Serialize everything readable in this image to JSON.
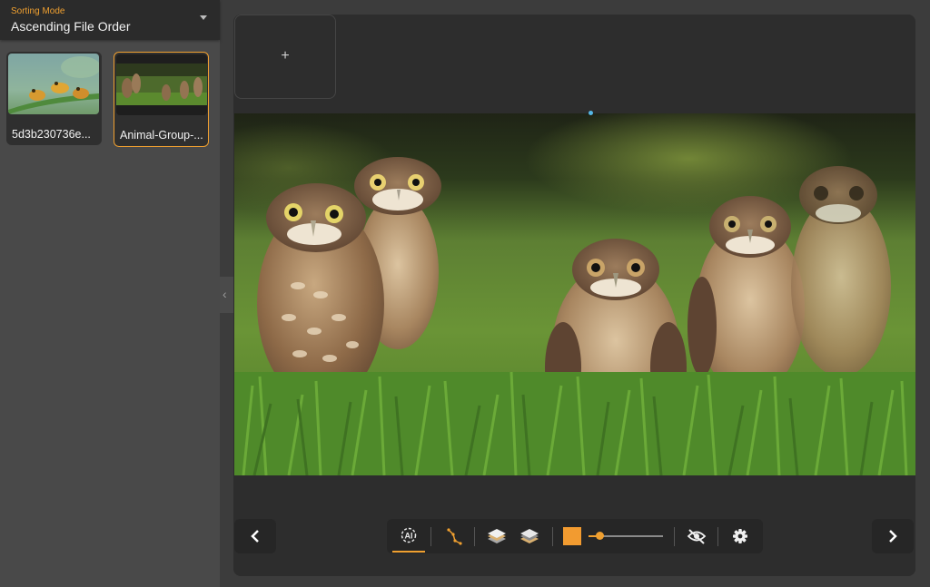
{
  "sidebar": {
    "sorting_label": "Sorting Mode",
    "sorting_value": "Ascending File Order",
    "thumbnails": [
      {
        "name": "5d3b230736e...",
        "selected": false
      },
      {
        "name": "Animal-Group-...",
        "selected": true
      }
    ]
  },
  "main": {
    "add_label": "+",
    "side_tab_glyph": "‹"
  },
  "toolbar": {
    "ai_label": "AI",
    "brush_size_fraction": 0.05,
    "colors": {
      "accent": "#f0a030",
      "swatch": "#f29b30",
      "panel": "#2d2d2d",
      "marker": "#55b7e6"
    },
    "icons": [
      "chevron-left-icon",
      "ai-select-icon",
      "polyline-icon",
      "layers-filled-icon",
      "layers-outline-icon",
      "color-swatch-icon",
      "eye-off-icon",
      "gear-icon",
      "chevron-right-icon"
    ]
  }
}
